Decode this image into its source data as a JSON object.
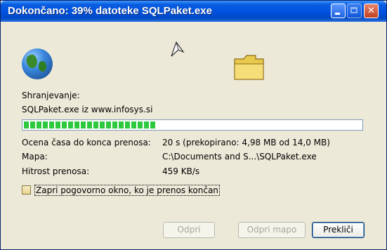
{
  "window": {
    "title": "Dokončano: 39% datoteke SQLPaket.exe",
    "accent": "#0053e1"
  },
  "icons": {
    "globe": "globe-icon",
    "paper": "flying-paper-icon",
    "folder": "folder-icon"
  },
  "status": {
    "saving_label": "Shranjevanje:",
    "source": "SQLPaket.exe iz www.infosys.si"
  },
  "progress": {
    "fraction": 0.39,
    "color": "#2cc93e"
  },
  "details": {
    "eta_label": "Ocena časa do konca prenosa:",
    "eta_value": "20 s (prekopirano: 4,98 MB od 14,0 MB)",
    "folder_label": "Mapa:",
    "folder_value": "C:\\Documents and S...\\SQLPaket.exe",
    "speed_label": "Hitrost prenosa:",
    "speed_value": "459 KB/s"
  },
  "options": {
    "close_when_done": "Zapri pogovorno okno, ko je prenos končan",
    "checked": false
  },
  "buttons": {
    "open": "Odpri",
    "open_folder": "Odpri mapo",
    "cancel": "Prekliči"
  }
}
